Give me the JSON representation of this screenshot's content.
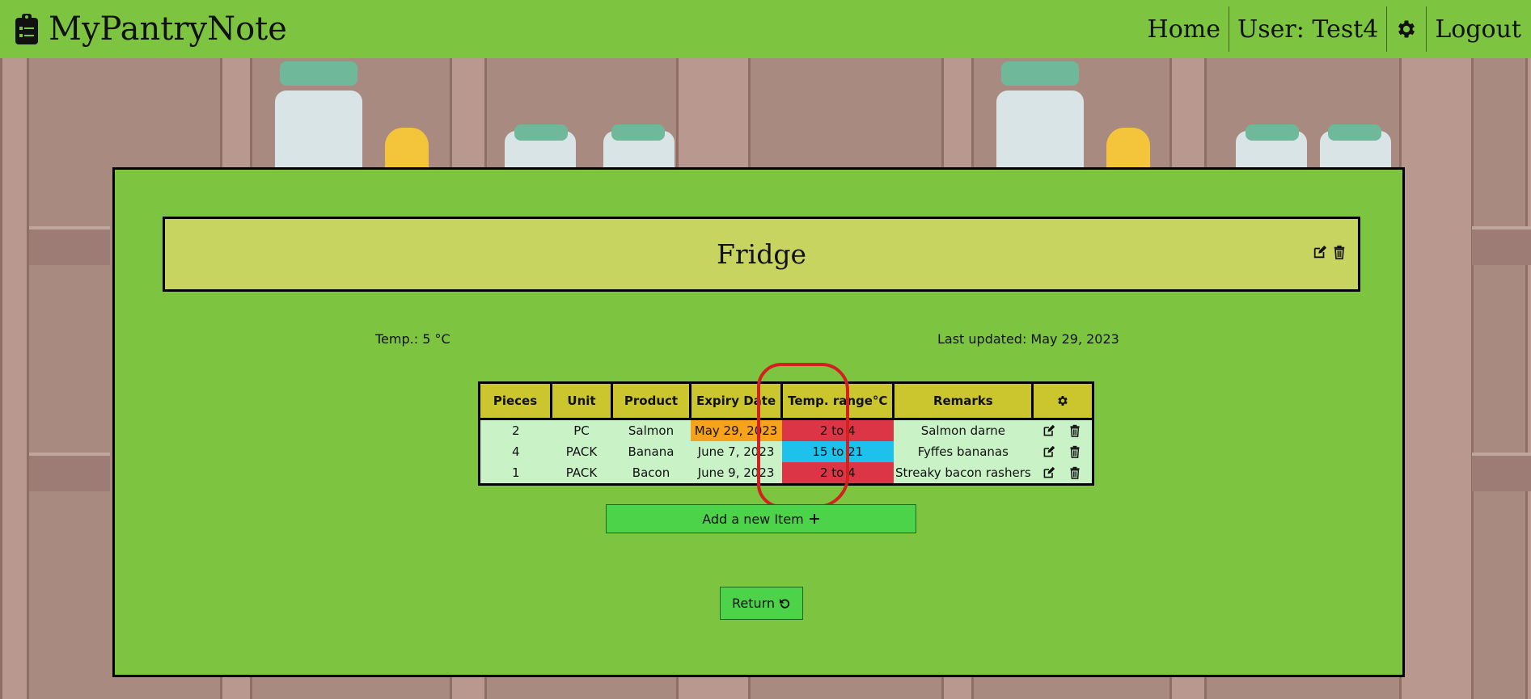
{
  "navbar": {
    "brand": "MyPantryNote",
    "home": "Home",
    "user": "User: Test4",
    "logout": "Logout"
  },
  "storage": {
    "title": "Fridge",
    "temp": "Temp.: 5 °C",
    "last_updated": "Last updated: May 29, 2023"
  },
  "table": {
    "headers": [
      "Pieces",
      "Unit",
      "Product",
      "Expiry Date",
      "Temp. range°C",
      "Remarks"
    ],
    "rows": [
      {
        "pieces": "2",
        "unit": "PC",
        "product": "Salmon",
        "expiry": "May 29, 2023",
        "range": "2 to 4",
        "remarks": "Salmon darne"
      },
      {
        "pieces": "4",
        "unit": "PACK",
        "product": "Banana",
        "expiry": "June 7, 2023",
        "range": "15 to 21",
        "remarks": "Fyffes bananas"
      },
      {
        "pieces": "1",
        "unit": "PACK",
        "product": "Bacon",
        "expiry": "June 9, 2023",
        "range": "2 to 4",
        "remarks": "Streaky bacon rashers"
      }
    ]
  },
  "buttons": {
    "add_item": "Add a new Item",
    "return": "Return"
  },
  "colors": {
    "green": "#7dc540",
    "warning": "#f7a21b",
    "danger": "#dc3545",
    "info": "#1ec0ec",
    "header": "#cbc62e"
  },
  "icons": [
    "clipboard-icon",
    "gear-icon",
    "edit-icon",
    "trash-icon",
    "plus-icon",
    "undo-icon"
  ]
}
